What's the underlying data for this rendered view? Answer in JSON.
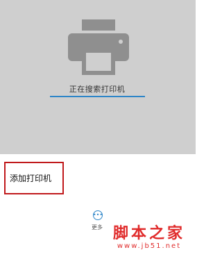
{
  "status": {
    "searching_text": "正在搜索打印机",
    "progress_fraction": 1.0
  },
  "actions": {
    "add_printer_label": "添加打印机",
    "more_label": "更多",
    "more_icon": "ellipsis-circle-icon"
  },
  "watermark": {
    "title": "脚本之家",
    "url": "www.jb51.net"
  },
  "colors": {
    "panel_bg": "#cfcfcf",
    "printer_icon": "#8f8f8f",
    "accent": "#2d85c8",
    "highlight_border": "#c0191b",
    "watermark": "#e02b2b"
  }
}
